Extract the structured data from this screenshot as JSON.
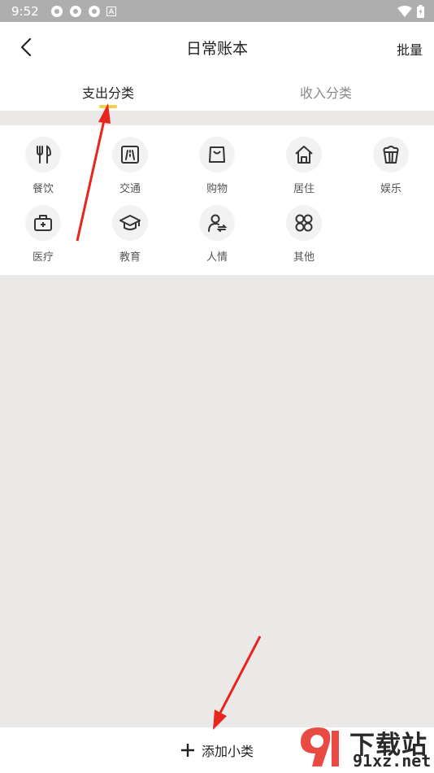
{
  "status_bar": {
    "time": "9:52"
  },
  "header": {
    "title": "日常账本",
    "batch_label": "批量"
  },
  "tabs": [
    {
      "label": "支出分类",
      "active": true
    },
    {
      "label": "收入分类",
      "active": false
    }
  ],
  "categories": [
    {
      "label": "餐饮",
      "icon": "utensils-icon"
    },
    {
      "label": "交通",
      "icon": "road-icon"
    },
    {
      "label": "购物",
      "icon": "shopping-bag-icon"
    },
    {
      "label": "居住",
      "icon": "house-icon"
    },
    {
      "label": "娱乐",
      "icon": "popcorn-icon"
    },
    {
      "label": "医疗",
      "icon": "medical-kit-icon"
    },
    {
      "label": "教育",
      "icon": "graduation-cap-icon"
    },
    {
      "label": "人情",
      "icon": "person-exchange-icon"
    },
    {
      "label": "其他",
      "icon": "four-loops-icon"
    }
  ],
  "bottom": {
    "add_label": "添加小类"
  },
  "watermark": {
    "brand": "下载站",
    "url": "91xz.net"
  },
  "colors": {
    "accent": "#f2d04a",
    "arrow": "#e8251f",
    "background": "#ebe9e8"
  }
}
